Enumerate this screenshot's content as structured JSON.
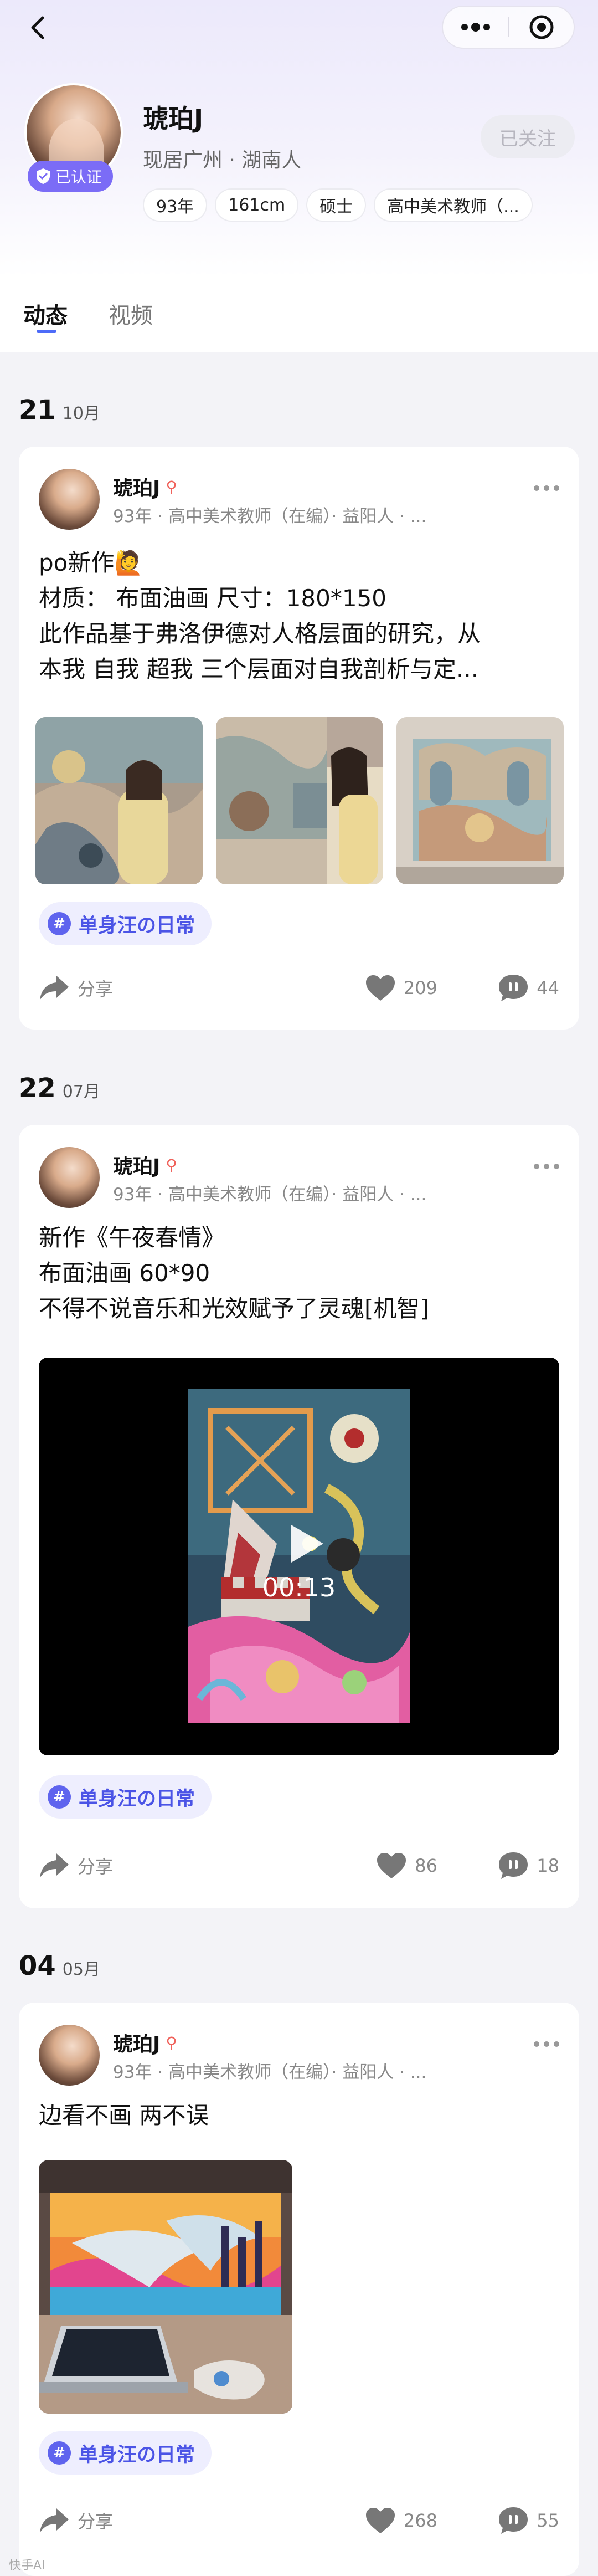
{
  "profile": {
    "name": "琥珀J",
    "verified_label": "已认证",
    "location": "现居广州 · 湖南人",
    "follow_label": "已关注",
    "tags": [
      "93年",
      "161cm",
      "硕士",
      "高中美术教师（..."
    ]
  },
  "tabs": [
    "动态",
    "视频"
  ],
  "posts": [
    {
      "date_day": "21",
      "date_month": "10月",
      "author": "琥珀J",
      "pin": "⚲",
      "meta": "93年 · 高中美术教师（在编）· 益阳人 · ...",
      "lines": [
        "po新作🙋",
        "材质： 布面油画 尺寸：180*150",
        "此作品基于弗洛伊德对人格层面的研究，从",
        "本我 自我 超我 三个层面对自我剖析与定..."
      ],
      "topic": "单身汪の日常",
      "share": "分享",
      "likes": "209",
      "comments": "44"
    },
    {
      "date_day": "22",
      "date_month": "07月",
      "author": "琥珀J",
      "pin": "⚲",
      "meta": "93年 · 高中美术教师（在编）· 益阳人 · ...",
      "lines": [
        "新作《午夜春情》",
        "布面油画 60*90",
        "不得不说音乐和光效赋予了灵魂[机智]"
      ],
      "video_duration": "00:13",
      "topic": "单身汪の日常",
      "share": "分享",
      "likes": "86",
      "comments": "18"
    },
    {
      "date_day": "04",
      "date_month": "05月",
      "author": "琥珀J",
      "pin": "⚲",
      "meta": "93年 · 高中美术教师（在编）· 益阳人 · ...",
      "lines": [
        "边看不画 两不误"
      ],
      "topic": "单身汪の日常",
      "share": "分享",
      "likes": "268",
      "comments": "55"
    }
  ],
  "watermark": "快手AI",
  "colors": {
    "accent": "#7b6cf6",
    "topic_text": "#4b54e6",
    "tab_indicator": "#4d6bf8",
    "pin": "#f0625b"
  },
  "icons": [
    "back-arrow-icon",
    "more-dots-icon",
    "target-icon",
    "verified-shield-icon",
    "location-pin-icon",
    "share-arrow-icon",
    "heart-icon",
    "comment-icon",
    "play-icon",
    "hash-icon"
  ]
}
